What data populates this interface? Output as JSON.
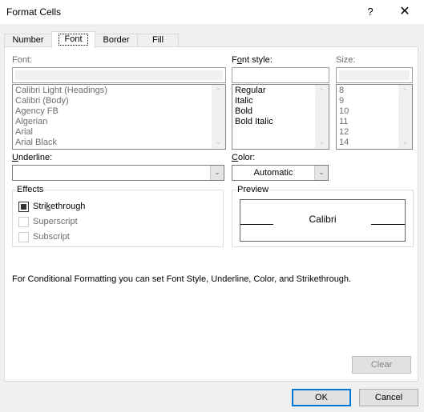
{
  "window": {
    "title": "Format Cells",
    "help_label": "?",
    "close_label": "✕"
  },
  "tabs": [
    {
      "label": "Number",
      "active": false
    },
    {
      "label": "Font",
      "active": true
    },
    {
      "label": "Border",
      "active": false
    },
    {
      "label": "Fill",
      "active": false
    }
  ],
  "font": {
    "label": "Font:",
    "value": "",
    "items": [
      "Calibri Light (Headings)",
      "Calibri (Body)",
      "Agency FB",
      "Algerian",
      "Arial",
      "Arial Black"
    ]
  },
  "font_style": {
    "label_pre": "F",
    "label_accel": "o",
    "label_post": "nt style:",
    "value": "",
    "items": [
      "Regular",
      "Italic",
      "Bold",
      "Bold Italic"
    ]
  },
  "size": {
    "label": "Size:",
    "value": "",
    "items": [
      "8",
      "9",
      "10",
      "11",
      "12",
      "14"
    ]
  },
  "underline": {
    "label_accel": "U",
    "label_post": "nderline:",
    "value": ""
  },
  "color": {
    "label_accel": "C",
    "label_post": "olor:",
    "value": "Automatic"
  },
  "effects": {
    "title": "Effects",
    "strikethrough": {
      "pre": "Stri",
      "accel": "k",
      "post": "ethrough",
      "checked": true,
      "enabled": true
    },
    "superscript": {
      "label": "Superscript",
      "checked": false,
      "enabled": false
    },
    "subscript": {
      "label": "Subscript",
      "checked": false,
      "enabled": false
    }
  },
  "preview": {
    "title": "Preview",
    "sample_text": "Calibri"
  },
  "info_text": "For Conditional Formatting you can set Font Style, Underline, Color, and Strikethrough.",
  "buttons": {
    "clear": "Clear",
    "ok": "OK",
    "cancel": "Cancel"
  },
  "icons": {
    "scroll_up": "⌃",
    "scroll_down": "⌄",
    "dropdown": "⌄"
  }
}
